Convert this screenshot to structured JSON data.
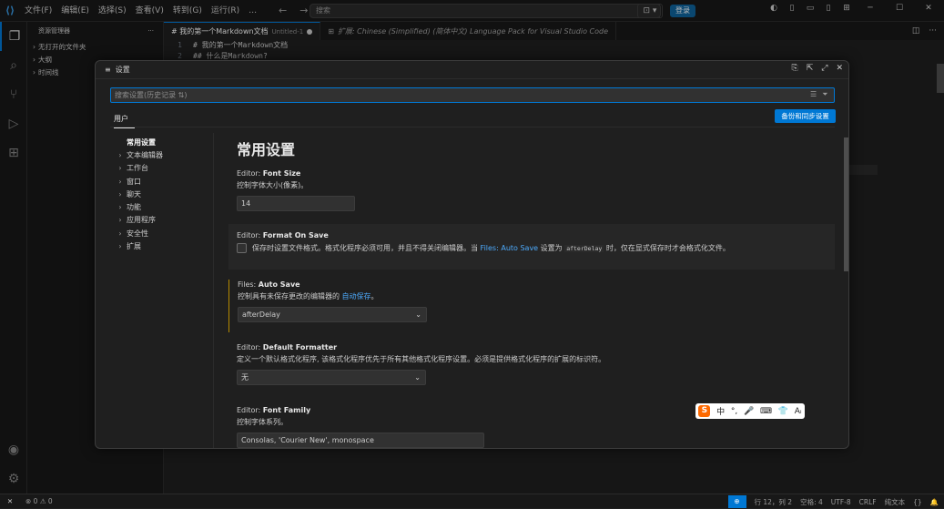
{
  "titlebar": {
    "menus": [
      "文件(F)",
      "编辑(E)",
      "选择(S)",
      "查看(V)",
      "转到(G)",
      "运行(R)",
      "…"
    ],
    "search_placeholder": "搜索",
    "login_label": "登录"
  },
  "sidebar": {
    "header": "资源管理器",
    "more": "···",
    "items": [
      {
        "label": "无打开的文件夹"
      },
      {
        "label": "大纲"
      },
      {
        "label": "时间线"
      }
    ]
  },
  "tabs": [
    {
      "label": "# 我的第一个Markdown文档",
      "sub": "Untitled-1",
      "active": true
    },
    {
      "label": "扩展: Chinese (Simplified) (简体中文) Language Pack for Visual Studio Code",
      "active": false
    }
  ],
  "editor": {
    "lines": [
      {
        "num": "1",
        "text": "# 我的第一个Markdown文档"
      },
      {
        "num": "2",
        "text": "## 什么是Markdown?"
      }
    ]
  },
  "settings": {
    "title": "设置",
    "search_placeholder": "搜索设置(历史记录 ⇅)",
    "scope_tab": "用户",
    "backup_button": "备份和同步设置",
    "toc": [
      {
        "label": "常用设置",
        "current": true,
        "chevron": ""
      },
      {
        "label": "文本编辑器",
        "chevron": "›"
      },
      {
        "label": "工作台",
        "chevron": "›"
      },
      {
        "label": "窗口",
        "chevron": "›"
      },
      {
        "label": "聊天",
        "chevron": "›"
      },
      {
        "label": "功能",
        "chevron": "›"
      },
      {
        "label": "应用程序",
        "chevron": "›"
      },
      {
        "label": "安全性",
        "chevron": "›"
      },
      {
        "label": "扩展",
        "chevron": "›"
      }
    ],
    "section_title": "常用设置",
    "font_size": {
      "prefix": "Editor: ",
      "name": "Font Size",
      "desc": "控制字体大小(像素)。",
      "value": "14"
    },
    "format_on_save": {
      "prefix": "Editor: ",
      "name": "Format On Save",
      "desc_a": "保存时设置文件格式。格式化程序必须可用，并且不得关闭编辑器。当 ",
      "desc_link": "Files: Auto Save",
      "desc_b": " 设置为 ",
      "desc_code": "afterDelay",
      "desc_c": " 时，仅在显式保存时才会格式化文件。",
      "checked": false
    },
    "auto_save": {
      "prefix": "Files: ",
      "name": "Auto Save",
      "desc_a": "控制具有未保存更改的编辑器的 ",
      "desc_link": "自动保存",
      "desc_b": "。",
      "value": "afterDelay"
    },
    "default_formatter": {
      "prefix": "Editor: ",
      "name": "Default Formatter",
      "desc": "定义一个默认格式化程序, 该格式化程序优先于所有其他格式化程序设置。必须是提供格式化程序的扩展的标识符。",
      "value": "无"
    },
    "font_family": {
      "prefix": "Editor: ",
      "name": "Font Family",
      "desc": "控制字体系列。",
      "value": "Consolas, 'Courier New', monospace"
    }
  },
  "ime": {
    "logo": "S",
    "items": [
      "中",
      "°,",
      "🎤",
      "⌨",
      "👕",
      "Aᵢ"
    ]
  },
  "statusbar": {
    "remote": "✕",
    "problems": "⊗ 0 ⚠ 0",
    "position": "行 12，列 2",
    "spaces": "空格: 4",
    "encoding": "UTF-8",
    "eol": "CRLF",
    "language": "纯文本",
    "feedback": "{}",
    "bell": "🔔"
  },
  "colors": {
    "accent": "#0078d4",
    "modified_bar": "#b58a00"
  }
}
